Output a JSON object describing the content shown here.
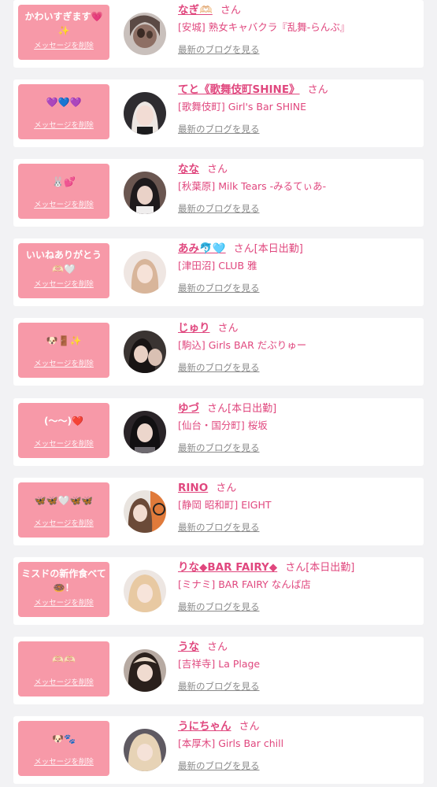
{
  "labels": {
    "delete": "メッセージを削除",
    "san": "さん",
    "blog": "最新のブログを見る"
  },
  "items": [
    {
      "message": "かわいすぎます💗✨",
      "name": "なぎ🫶🏻",
      "status": "",
      "shop": "[安城] 熟女キャバクラ『乱舞-らんぶ』"
    },
    {
      "message": "💜💙💜",
      "name": "てと《歌舞伎町SHINE》",
      "status": "",
      "shop": "[歌舞伎町] Girl's Bar SHINE"
    },
    {
      "message": "🐰💕",
      "name": "なな",
      "status": "",
      "shop": "[秋葉原] Milk Tears -みるてぃあ-"
    },
    {
      "message": "いいねありがとう🫶🏻🤍",
      "name": "あみ🐬🩵",
      "status": "[本日出勤]",
      "shop": "[津田沼] CLUB 雅"
    },
    {
      "message": "🐶🚪✨",
      "name": "じゅり",
      "status": "",
      "shop": "[駒込] Girls BAR だぶりゅー"
    },
    {
      "message": "(〜〜)❤️",
      "name": "ゆづ",
      "status": "[本日出勤]",
      "shop": "[仙台・国分町] 桜坂"
    },
    {
      "message": "🦋🦋🤍🦋🦋",
      "name": "RINO",
      "status": "",
      "shop": "[静岡 昭和町] EIGHT"
    },
    {
      "message": "ミスドの新作食べて🍩！",
      "name": "りな◆BAR FAIRY◆",
      "status": "[本日出勤]",
      "shop": "[ミナミ] BAR FAIRY なんば店"
    },
    {
      "message": "🫶🏻🫶🏻",
      "name": "うな",
      "status": "",
      "shop": "[吉祥寺] La Plage"
    },
    {
      "message": "🐶🐾",
      "name": "うにちゃん",
      "status": "",
      "shop": "[本厚木] Girls Bar chill"
    }
  ]
}
